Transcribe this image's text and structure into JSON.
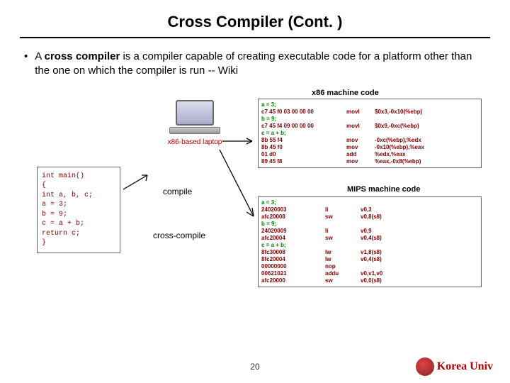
{
  "title": "Cross Compiler (Cont. )",
  "bullet": {
    "pre": "A ",
    "bold": "cross compiler",
    "post": " is a compiler capable of creating executable code for a platform other than the one on which the compiler is run -- Wiki"
  },
  "source": {
    "l1": "int main()",
    "l2": "{",
    "l3": "  int a, b, c;",
    "l4": "  a = 3;",
    "l5": "  b = 9;",
    "l6": "  c = a + b;",
    "l7": "  return c;",
    "l8": "}"
  },
  "laptop_label": "x86-based laptop",
  "labels": {
    "compile": "compile",
    "cross_compile": "cross-compile",
    "x86": "x86 machine code",
    "mips": "MIPS machine code"
  },
  "x86": {
    "s1": "a = 3;",
    "r1a": "c7 45 f0 03 00 00 00",
    "r1b": "movl",
    "r1c": "$0x3,-0x10(%ebp)",
    "s2": "b = 9;",
    "r2a": "c7 45 f4 09 00 00 00",
    "r2b": "movl",
    "r2c": "$0x9,-0xc(%ebp)",
    "s3": "c = a + b;",
    "r3a": "8b 55 f4",
    "r3b": "mov",
    "r3c": "-0xc(%ebp),%edx",
    "r4a": "8b 45 f0",
    "r4b": "mov",
    "r4c": "-0x10(%ebp),%eax",
    "r5a": "01 d0",
    "r5b": "add",
    "r5c": "%edx,%eax",
    "r6a": "89 45 f8",
    "r6b": "mov",
    "r6c": "%eax,-0x8(%ebp)"
  },
  "mips": {
    "s1": "a = 3;",
    "r1a": "24020003",
    "r1b": "li",
    "r1c": "v0,3",
    "r2a": "afc20008",
    "r2b": "sw",
    "r2c": "v0,8(s8)",
    "s2": "b = 9;",
    "r3a": "24020009",
    "r3b": "li",
    "r3c": "v0,9",
    "r4a": "afc20004",
    "r4b": "sw",
    "r4c": "v0,4(s8)",
    "s3": "c = a + b;",
    "r5a": "8fc30008",
    "r5b": "lw",
    "r5c": "v1,8(s8)",
    "r6a": "8fc20004",
    "r6b": "lw",
    "r6c": "v0,4(s8)",
    "r7a": "00000000",
    "r7b": "nop",
    "r7c": "",
    "r8a": "00621021",
    "r8b": "addu",
    "r8c": "v0,v1,v0",
    "r9a": "afc20000",
    "r9b": "sw",
    "r9c": "v0,0(s8)"
  },
  "page": "20",
  "university": "Korea Univ"
}
